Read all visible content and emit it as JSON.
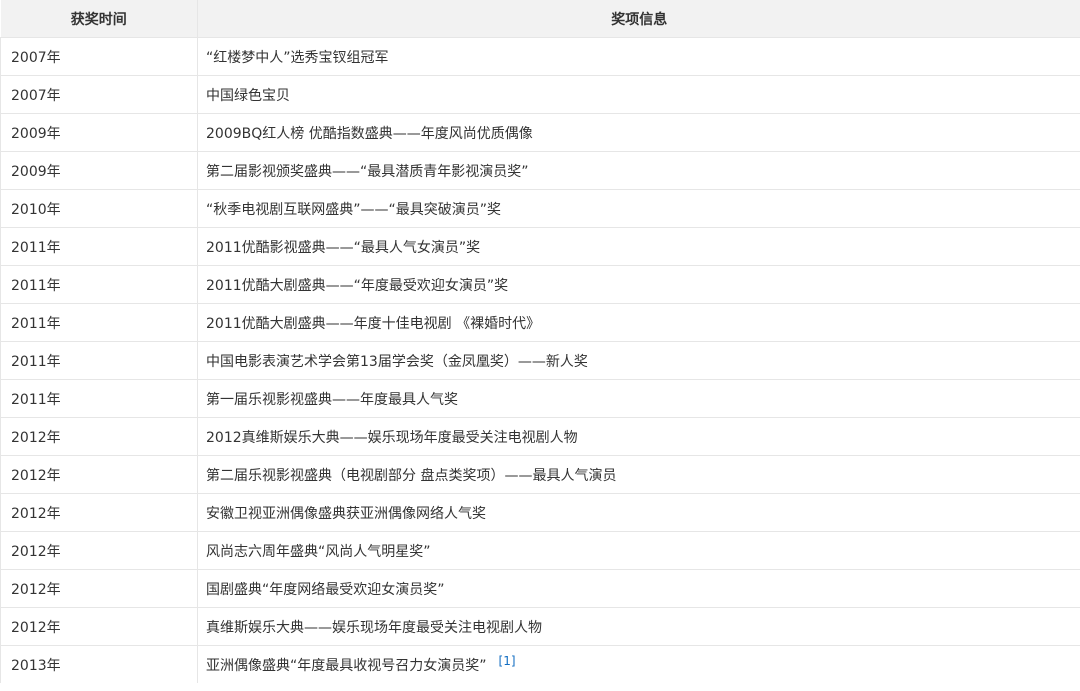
{
  "table": {
    "headers": [
      "获奖时间",
      "奖项信息"
    ],
    "rows": [
      {
        "year": "2007年",
        "award": "“红楼梦中人”选秀宝钗组冠军"
      },
      {
        "year": "2007年",
        "award": "中国绿色宝贝"
      },
      {
        "year": "2009年",
        "award": "2009BQ红人榜 优酷指数盛典——年度风尚优质偶像"
      },
      {
        "year": "2009年",
        "award": "第二届影视颁奖盛典——“最具潜质青年影视演员奖”"
      },
      {
        "year": "2010年",
        "award": "“秋季电视剧互联网盛典”——“最具突破演员”奖"
      },
      {
        "year": "2011年",
        "award": "2011优酷影视盛典——“最具人气女演员”奖"
      },
      {
        "year": "2011年",
        "award": "2011优酷大剧盛典——“年度最受欢迎女演员”奖"
      },
      {
        "year": "2011年",
        "award": "2011优酷大剧盛典——年度十佳电视剧 《裸婚时代》"
      },
      {
        "year": "2011年",
        "award": "中国电影表演艺术学会第13届学会奖（金凤凰奖）——新人奖"
      },
      {
        "year": "2011年",
        "award": "第一届乐视影视盛典——年度最具人气奖"
      },
      {
        "year": "2012年",
        "award": "2012真维斯娱乐大典——娱乐现场年度最受关注电视剧人物"
      },
      {
        "year": "2012年",
        "award": "第二届乐视影视盛典（电视剧部分 盘点类奖项）——最具人气演员"
      },
      {
        "year": "2012年",
        "award": "安徽卫视亚洲偶像盛典获亚洲偶像网络人气奖"
      },
      {
        "year": "2012年",
        "award": "风尚志六周年盛典“风尚人气明星奖”"
      },
      {
        "year": "2012年",
        "award": "国剧盛典“年度网络最受欢迎女演员奖”"
      },
      {
        "year": "2012年",
        "award": "真维斯娱乐大典——娱乐现场年度最受关注电视剧人物"
      },
      {
        "year": "2013年",
        "award": "亚洲偶像盛典“年度最具收视号召力女演员奖”",
        "ref": "[1]"
      }
    ]
  }
}
